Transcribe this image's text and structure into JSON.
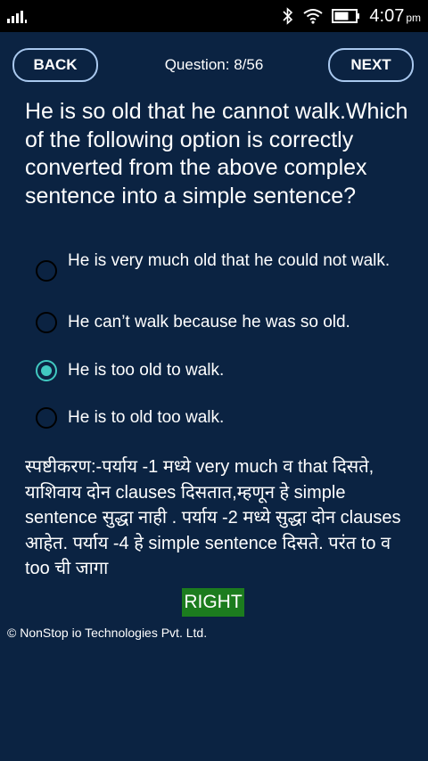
{
  "status_bar": {
    "time": "4:07",
    "ampm": "pm"
  },
  "header": {
    "back_label": "BACK",
    "question_counter": "Question: 8/56",
    "next_label": "NEXT"
  },
  "question": {
    "text": "He is so old that he cannot walk.Which of the following option is correctly converted from the above complex sentence into a simple sentence?"
  },
  "options": [
    {
      "label": "He is very much old that he could not walk.",
      "selected": false
    },
    {
      "label": "He can’t walk because he was so old.",
      "selected": false
    },
    {
      "label": "He is too old to walk.",
      "selected": true
    },
    {
      "label": "He is to old too walk.",
      "selected": false
    }
  ],
  "explanation": {
    "text": "स्पष्टीकरण:-पर्याय -1 मध्ये  very much व that दिसते,  याशिवाय दोन clauses दिसतात,म्हणून हे simple sentence सुद्धा नाही . पर्याय -2 मध्ये सुद्धा  दोन  clauses आहेत. पर्याय -4 हे  simple sentence दिसते. परंत  to व  too ची जागा"
  },
  "result": {
    "label": "RIGHT",
    "color": "#1c7c1e"
  },
  "footer": {
    "copyright": "© NonStop io Technologies Pvt. Ltd."
  },
  "colors": {
    "background": "#0b2342",
    "radio_checked": "#41c9c1",
    "button_border": "#a9c8ee"
  },
  "icons": {
    "signal": "signal-bars-icon",
    "bluetooth": "bluetooth-icon",
    "wifi": "wifi-icon",
    "battery": "battery-icon"
  }
}
